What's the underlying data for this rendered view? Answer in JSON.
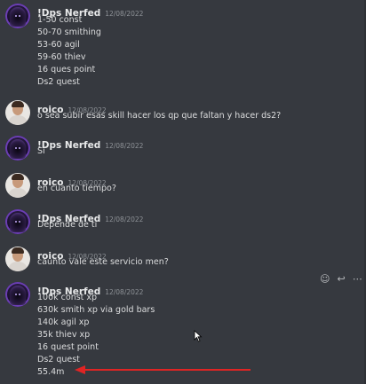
{
  "messages": [
    {
      "author": "!Dps Nerfed",
      "timestamp": "12/08/2022",
      "avatar": "purple-hood-avatar",
      "lines": [
        "1-50 const",
        "50-70 smithing",
        "53-60 agil",
        "59-60 thiev",
        "16 ques point",
        "Ds2 quest"
      ]
    },
    {
      "author": "roico",
      "timestamp": "12/08/2022",
      "avatar": "photo-avatar",
      "lines": [
        "o sea subir esas skill hacer los qp que faltan y hacer ds2?"
      ]
    },
    {
      "author": "!Dps Nerfed",
      "timestamp": "12/08/2022",
      "avatar": "purple-hood-avatar",
      "lines": [
        "Si"
      ]
    },
    {
      "author": "roico",
      "timestamp": "12/08/2022",
      "avatar": "photo-avatar",
      "lines": [
        "en cuanto tiempo?"
      ]
    },
    {
      "author": "!Dps Nerfed",
      "timestamp": "12/08/2022",
      "avatar": "purple-hood-avatar",
      "lines": [
        "Depende de ti"
      ]
    },
    {
      "author": "roico",
      "timestamp": "12/08/2022",
      "avatar": "photo-avatar",
      "lines": [
        "caunto vale este servicio men?"
      ]
    },
    {
      "author": "!Dps Nerfed",
      "timestamp": "12/08/2022",
      "avatar": "purple-hood-avatar",
      "lines": [
        "100k const xp",
        "630k smith  xp via gold bars",
        "140k agil xp",
        "35k thiev xp",
        "16 quest point",
        "Ds2 quest",
        "55.4m"
      ]
    }
  ],
  "hover_toolbar": {
    "add_reaction_icon": "add-reaction-icon",
    "reply_icon": "reply-icon",
    "more_icon": "more-icon",
    "add_reaction_glyph": "☺",
    "reply_glyph": "↩",
    "more_glyph": "⋯"
  },
  "colors": {
    "background": "#36393f",
    "text": "#dcddde",
    "username": "#e8e9ea",
    "timestamp": "#8e9297",
    "annotation_arrow": "#e02424"
  }
}
